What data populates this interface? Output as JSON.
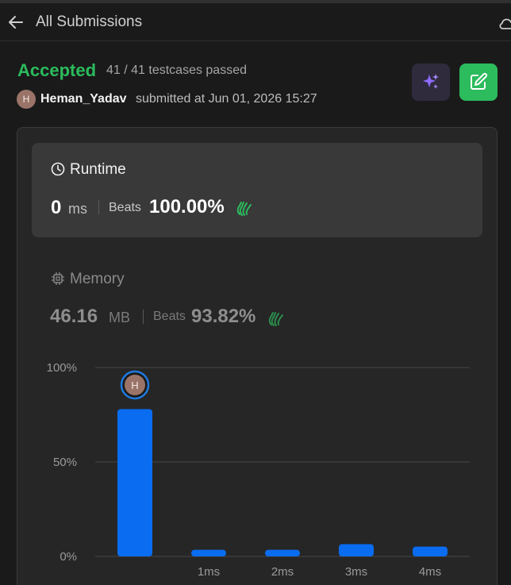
{
  "header": {
    "title": "All Submissions",
    "back_icon": "arrow-left-icon",
    "right_icon": "cloud-icon"
  },
  "submission": {
    "status": "Accepted",
    "testcases": "41 / 41 testcases passed",
    "avatar_initial": "H",
    "username": "Heman_Yadav",
    "submitted_text": "submitted at Jun 01, 2026 15:27"
  },
  "actions": {
    "ai_icon": "sparkles-icon",
    "edit_icon": "edit-icon"
  },
  "runtime": {
    "label": "Runtime",
    "value": "0",
    "unit": "ms",
    "beats_label": "Beats",
    "beats_pct": "100.00%"
  },
  "memory": {
    "label": "Memory",
    "value": "46.16",
    "unit": "MB",
    "beats_label": "Beats",
    "beats_pct": "93.82%"
  },
  "colors": {
    "accepted": "#2cbb5d",
    "bar": "#0a6cf0",
    "panel": "#262626",
    "card": "#393939"
  },
  "chart_data": {
    "type": "bar",
    "categories": [
      "",
      "1ms",
      "2ms",
      "3ms",
      "4ms"
    ],
    "values": [
      78,
      3.5,
      3.5,
      6.5,
      5.2
    ],
    "ylim": [
      0,
      100
    ],
    "y_ticks": [
      "0%",
      "50%",
      "100%"
    ],
    "y_tick_values": [
      0,
      50,
      100
    ],
    "marker_category_index": 0,
    "marker_initial": "H",
    "grid": true
  }
}
